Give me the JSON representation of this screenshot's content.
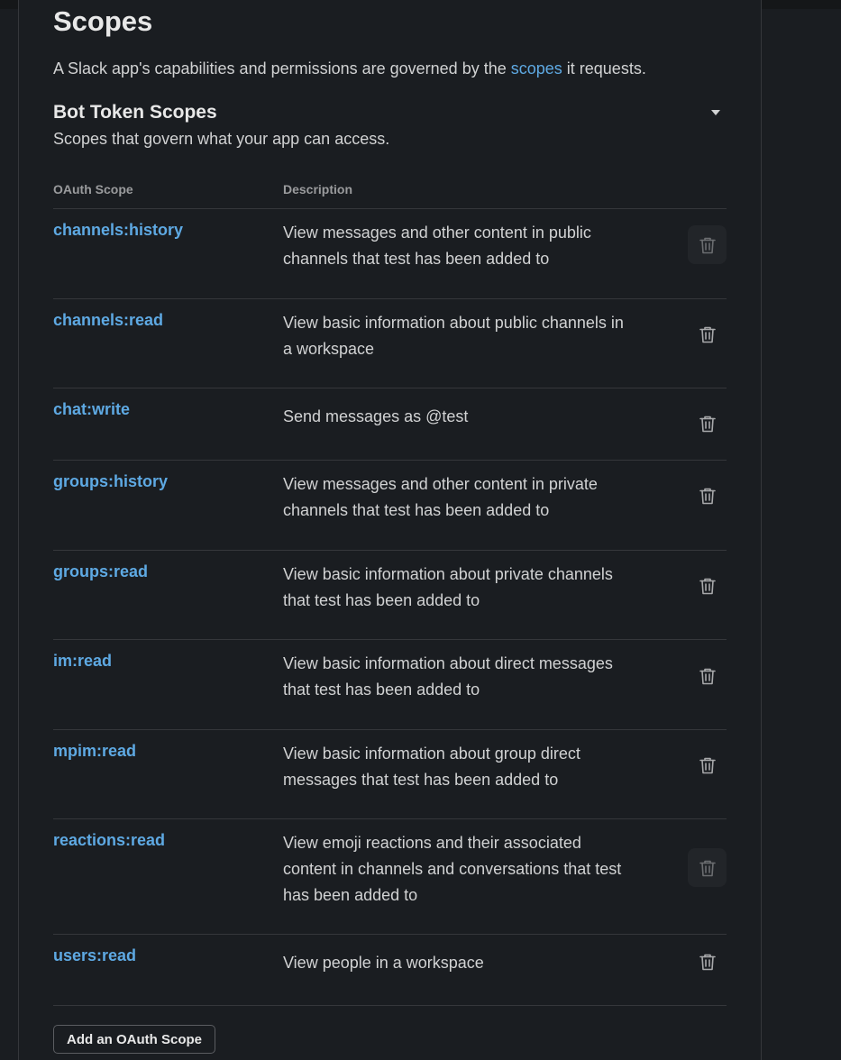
{
  "section": {
    "title": "Scopes",
    "intro_before": "A Slack app's capabilities and permissions are governed by the ",
    "intro_link": "scopes",
    "intro_after": " it requests."
  },
  "bot_scopes": {
    "title": "Bot Token Scopes",
    "description": "Scopes that govern what your app can access.",
    "toggle_icon": "caret-down-icon",
    "columns": {
      "scope": "OAuth Scope",
      "description": "Description"
    },
    "rows": [
      {
        "scope": "channels:history",
        "description": "View messages and other content in public channels that test has been added to"
      },
      {
        "scope": "channels:read",
        "description": "View basic information about public channels in a workspace"
      },
      {
        "scope": "chat:write",
        "description": "Send messages as @test"
      },
      {
        "scope": "groups:history",
        "description": "View messages and other content in private channels that test has been added to"
      },
      {
        "scope": "groups:read",
        "description": "View basic information about private channels that test has been added to"
      },
      {
        "scope": "im:read",
        "description": "View basic information about direct messages that test has been added to"
      },
      {
        "scope": "mpim:read",
        "description": "View basic information about group direct messages that test has been added to"
      },
      {
        "scope": "reactions:read",
        "description": "View emoji reactions and their associated content in channels and conversations that test has been added to"
      },
      {
        "scope": "users:read",
        "description": "View people in a workspace"
      }
    ],
    "add_button_label": "Add an OAuth Scope"
  },
  "colors": {
    "background": "#1a1d21",
    "link": "#5ea9e3",
    "text": "#d1d2d3",
    "divider": "#35373b"
  }
}
